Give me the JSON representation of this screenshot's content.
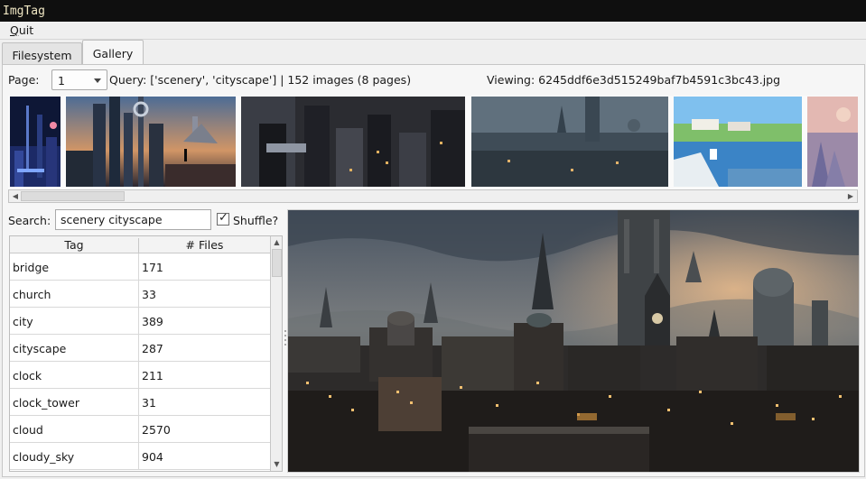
{
  "window": {
    "title": "ImgTag"
  },
  "menu": {
    "quit_first": "Q",
    "quit_rest": "uit"
  },
  "tabs": [
    {
      "label": "Filesystem",
      "active": false
    },
    {
      "label": "Gallery",
      "active": true
    }
  ],
  "gallery": {
    "page_label": "Page:",
    "page_value": "1",
    "query_text": "Query: ['scenery', 'cityscape'] | 152 images (8 pages)",
    "viewing_text": "Viewing: 6245ddf6e3d515249baf7b4591c3bc43.jpg",
    "search_label": "Search:",
    "search_value": "scenery cityscape",
    "shuffle_label": "Shuffle?",
    "shuffle_checked": true,
    "shuffle_mark": "✓"
  },
  "table": {
    "columns": [
      "Tag",
      "# Files"
    ],
    "rows": [
      {
        "tag": "bridge",
        "count": "171"
      },
      {
        "tag": "church",
        "count": "33"
      },
      {
        "tag": "city",
        "count": "389"
      },
      {
        "tag": "cityscape",
        "count": "287"
      },
      {
        "tag": "clock",
        "count": "211"
      },
      {
        "tag": "clock_tower",
        "count": "31"
      },
      {
        "tag": "cloud",
        "count": "2570"
      },
      {
        "tag": "cloudy_sky",
        "count": "904"
      }
    ]
  },
  "scroll_arrows": {
    "left": "◀",
    "right": "▶",
    "up": "▲",
    "down": "▼"
  },
  "colors": {
    "title_bar": "#0f0f0f",
    "title_text": "#efe6c3",
    "panel_bg": "#f6f6f6"
  }
}
